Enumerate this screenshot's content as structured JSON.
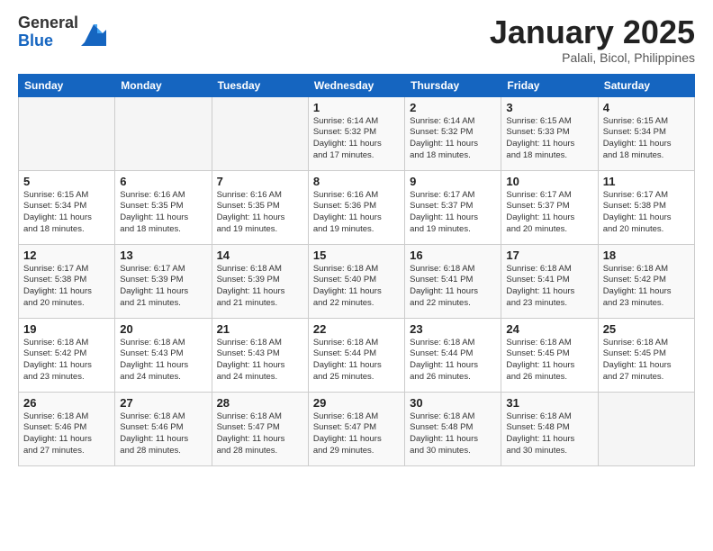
{
  "header": {
    "logo_general": "General",
    "logo_blue": "Blue",
    "month_title": "January 2025",
    "subtitle": "Palali, Bicol, Philippines"
  },
  "days_of_week": [
    "Sunday",
    "Monday",
    "Tuesday",
    "Wednesday",
    "Thursday",
    "Friday",
    "Saturday"
  ],
  "weeks": [
    [
      {
        "day": "",
        "info": ""
      },
      {
        "day": "",
        "info": ""
      },
      {
        "day": "",
        "info": ""
      },
      {
        "day": "1",
        "info": "Sunrise: 6:14 AM\nSunset: 5:32 PM\nDaylight: 11 hours\nand 17 minutes."
      },
      {
        "day": "2",
        "info": "Sunrise: 6:14 AM\nSunset: 5:32 PM\nDaylight: 11 hours\nand 18 minutes."
      },
      {
        "day": "3",
        "info": "Sunrise: 6:15 AM\nSunset: 5:33 PM\nDaylight: 11 hours\nand 18 minutes."
      },
      {
        "day": "4",
        "info": "Sunrise: 6:15 AM\nSunset: 5:34 PM\nDaylight: 11 hours\nand 18 minutes."
      }
    ],
    [
      {
        "day": "5",
        "info": "Sunrise: 6:15 AM\nSunset: 5:34 PM\nDaylight: 11 hours\nand 18 minutes."
      },
      {
        "day": "6",
        "info": "Sunrise: 6:16 AM\nSunset: 5:35 PM\nDaylight: 11 hours\nand 18 minutes."
      },
      {
        "day": "7",
        "info": "Sunrise: 6:16 AM\nSunset: 5:35 PM\nDaylight: 11 hours\nand 19 minutes."
      },
      {
        "day": "8",
        "info": "Sunrise: 6:16 AM\nSunset: 5:36 PM\nDaylight: 11 hours\nand 19 minutes."
      },
      {
        "day": "9",
        "info": "Sunrise: 6:17 AM\nSunset: 5:37 PM\nDaylight: 11 hours\nand 19 minutes."
      },
      {
        "day": "10",
        "info": "Sunrise: 6:17 AM\nSunset: 5:37 PM\nDaylight: 11 hours\nand 20 minutes."
      },
      {
        "day": "11",
        "info": "Sunrise: 6:17 AM\nSunset: 5:38 PM\nDaylight: 11 hours\nand 20 minutes."
      }
    ],
    [
      {
        "day": "12",
        "info": "Sunrise: 6:17 AM\nSunset: 5:38 PM\nDaylight: 11 hours\nand 20 minutes."
      },
      {
        "day": "13",
        "info": "Sunrise: 6:17 AM\nSunset: 5:39 PM\nDaylight: 11 hours\nand 21 minutes."
      },
      {
        "day": "14",
        "info": "Sunrise: 6:18 AM\nSunset: 5:39 PM\nDaylight: 11 hours\nand 21 minutes."
      },
      {
        "day": "15",
        "info": "Sunrise: 6:18 AM\nSunset: 5:40 PM\nDaylight: 11 hours\nand 22 minutes."
      },
      {
        "day": "16",
        "info": "Sunrise: 6:18 AM\nSunset: 5:41 PM\nDaylight: 11 hours\nand 22 minutes."
      },
      {
        "day": "17",
        "info": "Sunrise: 6:18 AM\nSunset: 5:41 PM\nDaylight: 11 hours\nand 23 minutes."
      },
      {
        "day": "18",
        "info": "Sunrise: 6:18 AM\nSunset: 5:42 PM\nDaylight: 11 hours\nand 23 minutes."
      }
    ],
    [
      {
        "day": "19",
        "info": "Sunrise: 6:18 AM\nSunset: 5:42 PM\nDaylight: 11 hours\nand 23 minutes."
      },
      {
        "day": "20",
        "info": "Sunrise: 6:18 AM\nSunset: 5:43 PM\nDaylight: 11 hours\nand 24 minutes."
      },
      {
        "day": "21",
        "info": "Sunrise: 6:18 AM\nSunset: 5:43 PM\nDaylight: 11 hours\nand 24 minutes."
      },
      {
        "day": "22",
        "info": "Sunrise: 6:18 AM\nSunset: 5:44 PM\nDaylight: 11 hours\nand 25 minutes."
      },
      {
        "day": "23",
        "info": "Sunrise: 6:18 AM\nSunset: 5:44 PM\nDaylight: 11 hours\nand 26 minutes."
      },
      {
        "day": "24",
        "info": "Sunrise: 6:18 AM\nSunset: 5:45 PM\nDaylight: 11 hours\nand 26 minutes."
      },
      {
        "day": "25",
        "info": "Sunrise: 6:18 AM\nSunset: 5:45 PM\nDaylight: 11 hours\nand 27 minutes."
      }
    ],
    [
      {
        "day": "26",
        "info": "Sunrise: 6:18 AM\nSunset: 5:46 PM\nDaylight: 11 hours\nand 27 minutes."
      },
      {
        "day": "27",
        "info": "Sunrise: 6:18 AM\nSunset: 5:46 PM\nDaylight: 11 hours\nand 28 minutes."
      },
      {
        "day": "28",
        "info": "Sunrise: 6:18 AM\nSunset: 5:47 PM\nDaylight: 11 hours\nand 28 minutes."
      },
      {
        "day": "29",
        "info": "Sunrise: 6:18 AM\nSunset: 5:47 PM\nDaylight: 11 hours\nand 29 minutes."
      },
      {
        "day": "30",
        "info": "Sunrise: 6:18 AM\nSunset: 5:48 PM\nDaylight: 11 hours\nand 30 minutes."
      },
      {
        "day": "31",
        "info": "Sunrise: 6:18 AM\nSunset: 5:48 PM\nDaylight: 11 hours\nand 30 minutes."
      },
      {
        "day": "",
        "info": ""
      }
    ]
  ]
}
